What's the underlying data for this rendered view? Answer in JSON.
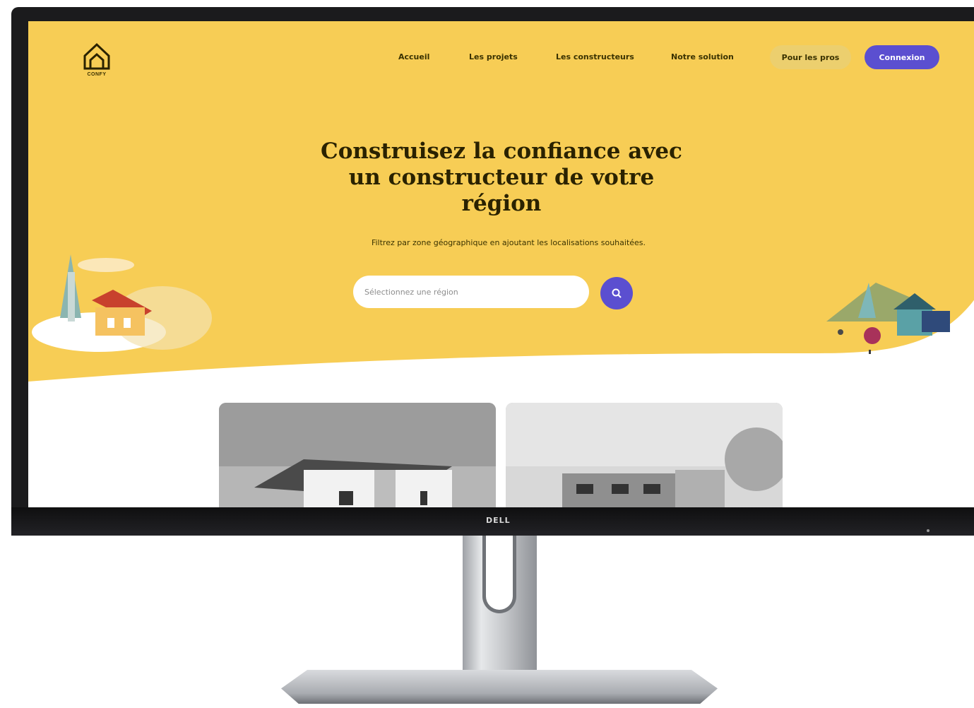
{
  "site": {
    "logo_text": "CONFY",
    "nav": {
      "items": [
        {
          "label": "Accueil"
        },
        {
          "label": "Les projets"
        },
        {
          "label": "Les constructeurs"
        },
        {
          "label": "Notre solution"
        }
      ],
      "price_button": "Pour les pros",
      "connect_button": "Connexion"
    },
    "hero": {
      "title": "Construisez la confiance avec un constructeur de votre région",
      "subtitle": "Filtrez par zone géographique en ajoutant les localisations souhaitées.",
      "search_placeholder": "Sélectionnez une région"
    }
  },
  "monitor": {
    "brand": "DELL"
  },
  "colors": {
    "hero_yellow": "#f7cd55",
    "accent_purple": "#5b4fd0",
    "pro_button": "#eccf6e",
    "bezel": "#1b1b1d"
  },
  "icons": [
    "house-logo-icon",
    "search-icon",
    "house-illustration-left-icon",
    "house-illustration-right-icon"
  ]
}
